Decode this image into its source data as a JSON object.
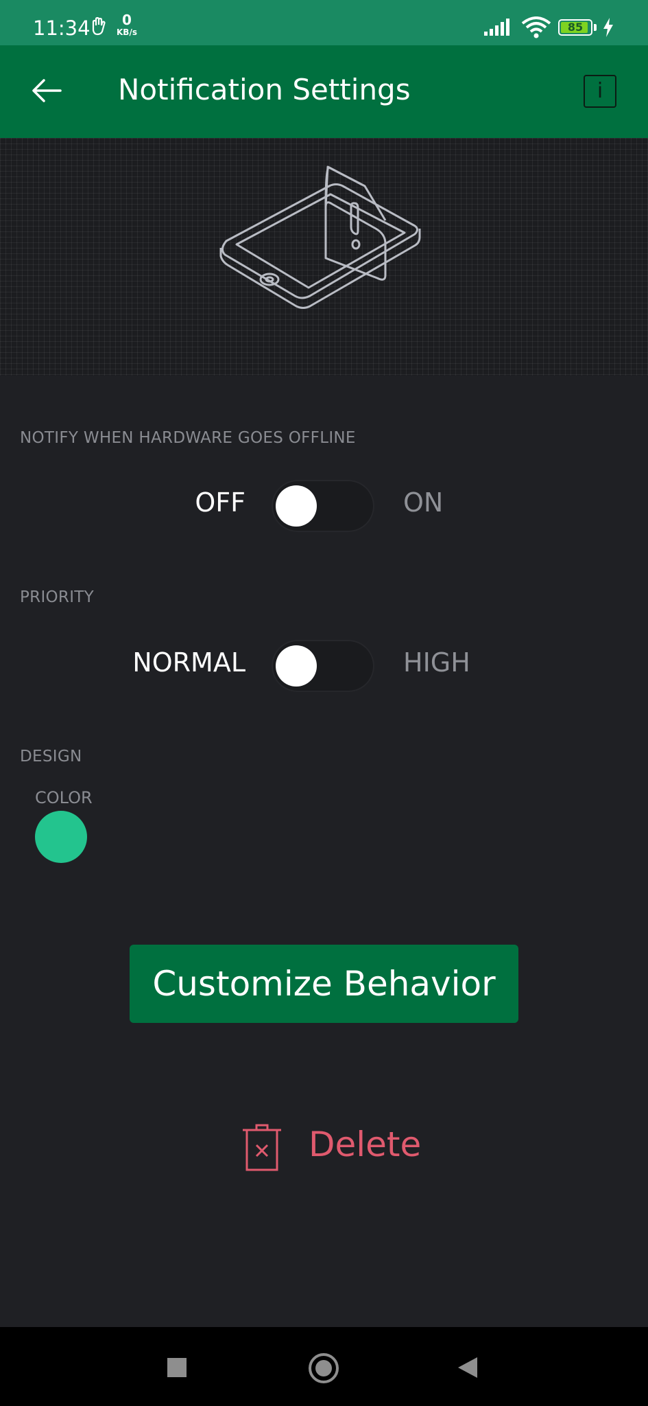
{
  "status_bar": {
    "time": "11:34",
    "net_speed_value": "0",
    "net_speed_unit": "KB/s",
    "battery_level": "85",
    "icons": [
      "hand-icon",
      "signal-icon",
      "wifi-icon",
      "battery-icon",
      "charging-bolt-icon"
    ]
  },
  "app_bar": {
    "title": "Notification Settings",
    "back_icon": "arrow-left-icon",
    "info_label": "i"
  },
  "hero": {
    "illustration": "phone-alert-illustration"
  },
  "offline_section": {
    "label": "NOTIFY WHEN HARDWARE GOES OFFLINE",
    "off_label": "OFF",
    "on_label": "ON",
    "value": "OFF"
  },
  "priority_section": {
    "label": "PRIORITY",
    "low_label": "NORMAL",
    "high_label": "HIGH",
    "value": "NORMAL"
  },
  "design_section": {
    "label": "DESIGN",
    "color_label": "COLOR",
    "color_value": "#23c48e"
  },
  "actions": {
    "customize_label": "Customize Behavior",
    "delete_label": "Delete"
  },
  "colors": {
    "accent": "#00703f",
    "status_bar": "#1a8a62",
    "background": "#1f2024",
    "delete": "#e05a6e"
  },
  "nav_bar": {
    "icons": [
      "recents-icon",
      "home-icon",
      "back-triangle-icon"
    ]
  }
}
